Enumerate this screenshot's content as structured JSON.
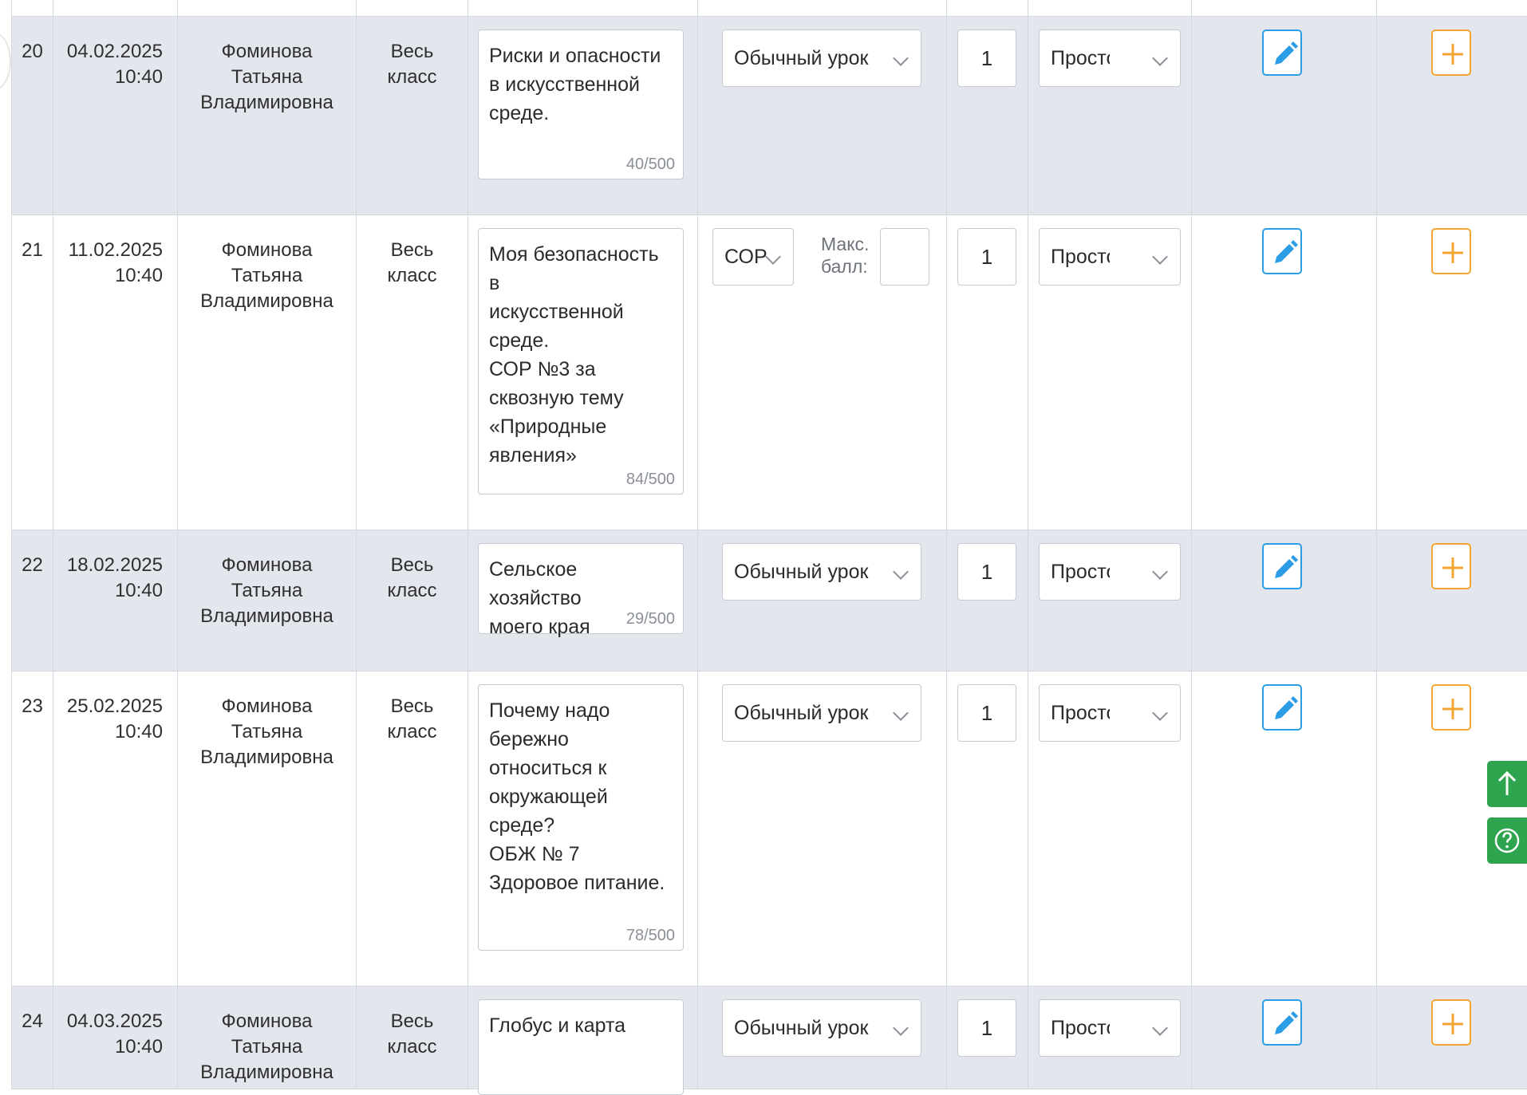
{
  "table": {
    "rows": [
      {
        "num": "20",
        "date": "04.02.2025",
        "time": "10:40",
        "teacher": "Фоминова\nТатьяна\nВладимировна",
        "group": "Весь\nкласс",
        "topic": "Риски и опасности\nв искусственной\nсреде.",
        "counter": "40/500",
        "type": "Обычный урок",
        "hours": "1",
        "mode": "Простой"
      },
      {
        "num": "21",
        "date": "11.02.2025",
        "time": "10:40",
        "teacher": "Фоминова\nТатьяна\nВладимировна",
        "group": "Весь\nкласс",
        "topic": "Моя безопасность в\nискусственной\nсреде.\nСОР №3 за\nсквозную тему\n«Природные\nявления»",
        "counter": "84/500",
        "type": "СОР",
        "max_score_label": "Макс.\nбалл:",
        "max_score_value": "",
        "hours": "1",
        "mode": "Простой"
      },
      {
        "num": "22",
        "date": "18.02.2025",
        "time": "10:40",
        "teacher": "Фоминова\nТатьяна\nВладимировна",
        "group": "Весь\nкласс",
        "topic": "Сельское хозяйство\nмоего края",
        "counter": "29/500",
        "type": "Обычный урок",
        "hours": "1",
        "mode": "Простой"
      },
      {
        "num": "23",
        "date": "25.02.2025",
        "time": "10:40",
        "teacher": "Фоминова\nТатьяна\nВладимировна",
        "group": "Весь\nкласс",
        "topic": "Почему надо\nбережно\nотноситься к\nокружающей\nсреде?\nОБЖ № 7\nЗдоровое питание.",
        "counter": "78/500",
        "type": "Обычный урок",
        "hours": "1",
        "mode": "Простой"
      },
      {
        "num": "24",
        "date": "04.03.2025",
        "time": "10:40",
        "teacher": "Фоминова\nТатьяна\nВладимировна",
        "group": "Весь\nкласс",
        "topic": "Глобус и карта",
        "counter": "",
        "type": "Обычный урок",
        "hours": "1",
        "mode": "Простой"
      }
    ]
  },
  "icons": {
    "edit": "pencil-icon",
    "add": "plus-icon",
    "scroll_top": "arrow-up-icon",
    "help": "question-circle-icon",
    "dropdown": "chevron-down-icon"
  },
  "colors": {
    "row_grey": "#e3e6ec",
    "edit_blue": "#2a9de6",
    "add_orange": "#f2a531",
    "float_green": "#2ea44f"
  }
}
